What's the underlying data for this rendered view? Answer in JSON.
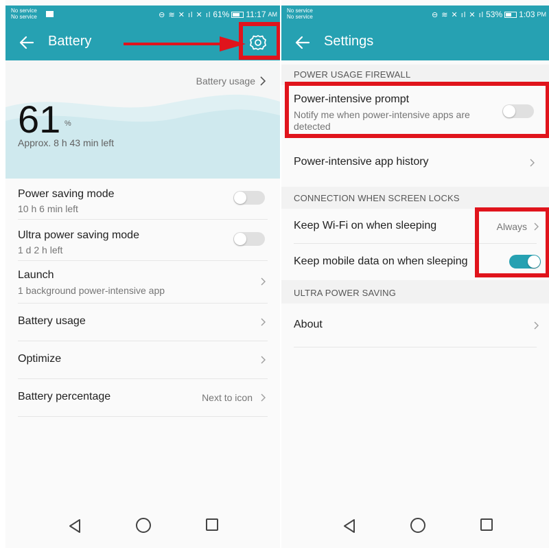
{
  "left": {
    "status": {
      "carrier1": "No service",
      "carrier2": "No service",
      "battery_percent": "61%",
      "time": "11:17",
      "ampm": "AM"
    },
    "appbar": {
      "title": "Battery"
    },
    "hero": {
      "usage_link": "Battery usage",
      "percent": "61",
      "percent_unit": "%",
      "remaining": "Approx. 8 h 43 min left"
    },
    "rows": [
      {
        "title": "Power saving mode",
        "sub": "10 h 6 min left",
        "toggle_on": false
      },
      {
        "title": "Ultra power saving mode",
        "sub": "1 d 2 h left",
        "toggle_on": false
      },
      {
        "title": "Launch",
        "sub": "1 background power-intensive app"
      },
      {
        "title": "Battery usage"
      },
      {
        "title": "Optimize"
      },
      {
        "title": "Battery percentage",
        "value": "Next to icon"
      }
    ]
  },
  "right": {
    "status": {
      "carrier1": "No service",
      "carrier2": "No service",
      "battery_percent": "53%",
      "time": "1:03",
      "ampm": "PM"
    },
    "appbar": {
      "title": "Settings"
    },
    "sections": [
      "POWER USAGE FIREWALL",
      "CONNECTION WHEN SCREEN LOCKS",
      "ULTRA POWER SAVING"
    ],
    "rows": [
      {
        "title": "Power-intensive prompt",
        "sub": "Notify me when power-intensive apps are detected",
        "toggle_on": false
      },
      {
        "title": "Power-intensive app history"
      },
      {
        "title": "Keep Wi-Fi on when sleeping",
        "value": "Always"
      },
      {
        "title": "Keep mobile data on when sleeping",
        "toggle_on": true
      },
      {
        "title": "About"
      }
    ]
  },
  "colors": {
    "accent": "#26a1b2",
    "highlight": "#e0141c"
  },
  "icons": [
    "back-arrow-icon",
    "gear-icon",
    "chevron-right-icon",
    "nav-back-icon",
    "nav-home-icon",
    "nav-recents-icon"
  ]
}
